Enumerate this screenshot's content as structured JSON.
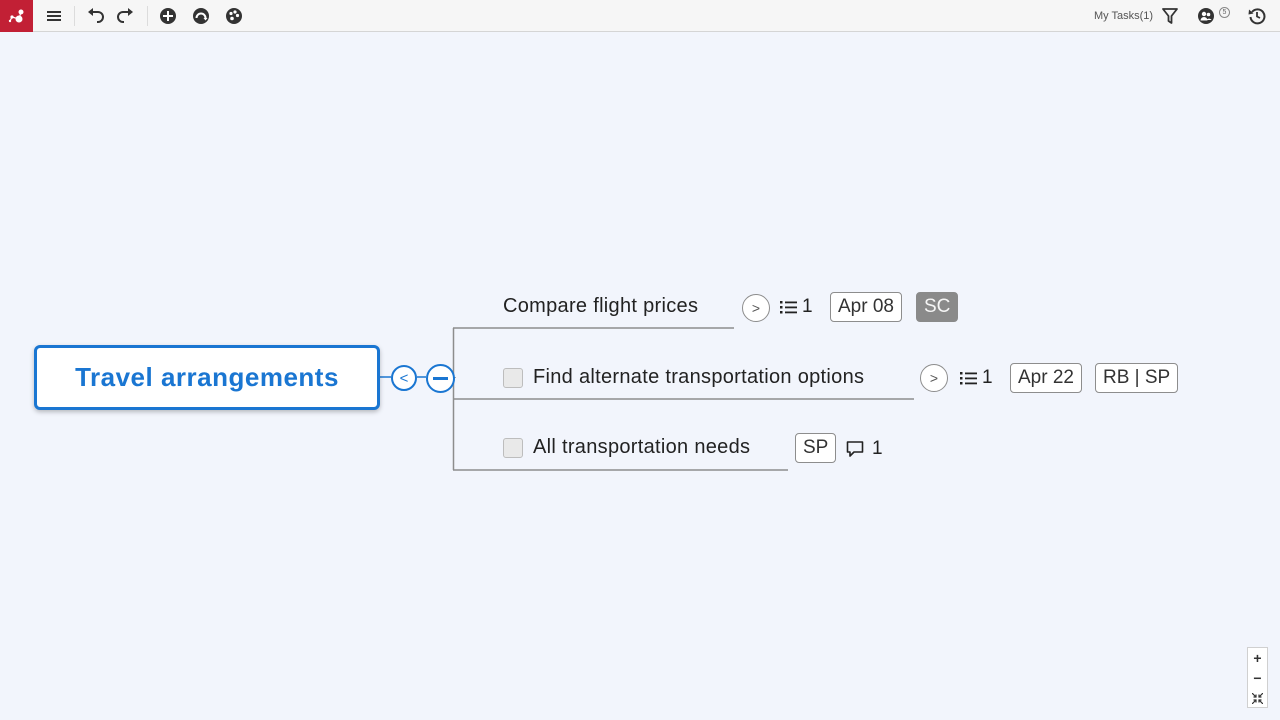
{
  "toolbar": {
    "my_tasks_label": "My Tasks(1)",
    "collaborators_count": "5",
    "colors": {
      "logo_bg": "#c22035",
      "icon": "#333333"
    }
  },
  "map": {
    "central_topic": "Travel arrangements",
    "collapse_left_symbol": "<",
    "accent_color": "#1a76d2",
    "topics": [
      {
        "label": "Compare flight prices",
        "has_checkbox": false,
        "expand_symbol": ">",
        "task_count": "1",
        "due_date": "Apr 08",
        "assignee": "SC"
      },
      {
        "label": "Find alternate transportation options",
        "has_checkbox": true,
        "expand_symbol": ">",
        "task_count": "1",
        "due_date": "Apr 22",
        "assignee": "RB | SP"
      },
      {
        "label": "All transportation needs",
        "has_checkbox": true,
        "assignee": "SP",
        "comment_count": "1"
      }
    ]
  },
  "zoom": {
    "plus": "+",
    "minus": "−"
  }
}
